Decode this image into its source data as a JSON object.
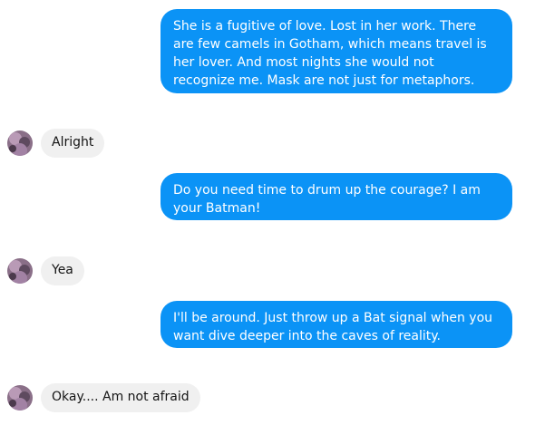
{
  "messages": [
    {
      "direction": "outgoing",
      "text": "She is a fugitive of love. Lost in her work. There are few camels in Gotham, which means travel is her lover. And most nights she would not recognize me. Mask are not just for metaphors."
    },
    {
      "direction": "incoming",
      "text": "Alright"
    },
    {
      "direction": "outgoing",
      "text": "Do you need time to drum up the courage? I am your Batman!"
    },
    {
      "direction": "incoming",
      "text": "Yea"
    },
    {
      "direction": "outgoing",
      "text": "I'll be around. Just throw up a Bat signal when you want dive deeper into the caves of reality."
    },
    {
      "direction": "incoming",
      "text": "Okay.... Am not afraid"
    }
  ],
  "colors": {
    "outgoing_bubble": "#0b93f6",
    "incoming_bubble": "#f0f0f0"
  }
}
